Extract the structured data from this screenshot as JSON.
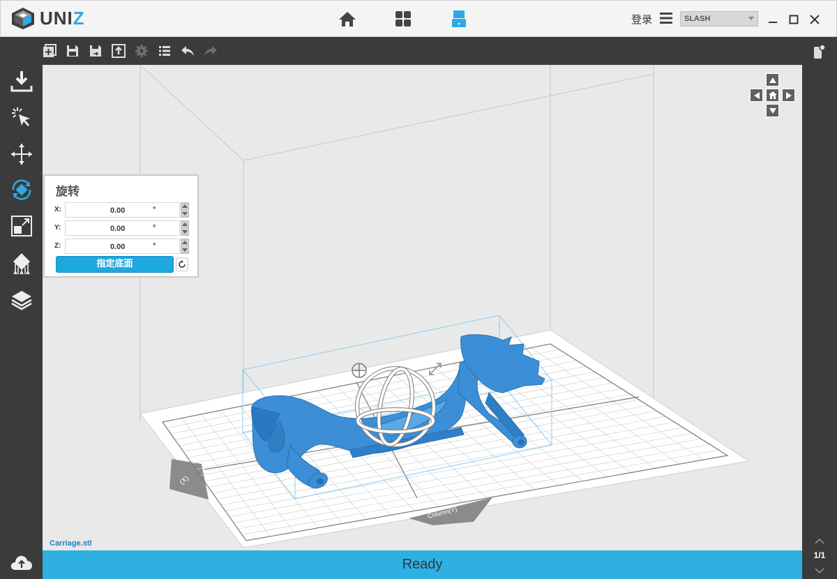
{
  "app": {
    "logo_text": "UNI",
    "logo_accent": "Z",
    "accent_color": "#2fa9e3"
  },
  "titlebar": {
    "nav": [
      {
        "name": "home-icon"
      },
      {
        "name": "grid-icon"
      },
      {
        "name": "printer-icon",
        "active": true
      }
    ],
    "login_label": "登录",
    "printer_model": "SLASH"
  },
  "toolbar": {
    "icons": [
      "add-model-icon",
      "save-icon",
      "save-as-icon",
      "export-icon",
      "settings-icon",
      "list-icon",
      "undo-icon",
      "redo-icon"
    ]
  },
  "sidebar": {
    "tools": [
      "import-icon",
      "select-icon",
      "move-icon",
      "rotate-icon",
      "scale-icon",
      "support-icon",
      "layers-icon"
    ],
    "active_tool": "rotate-icon"
  },
  "rotate_panel": {
    "title": "旋转",
    "rows": [
      {
        "label": "X:",
        "value": "0.00",
        "unit": "°"
      },
      {
        "label": "Y:",
        "value": "0.00",
        "unit": "°"
      },
      {
        "label": "Z:",
        "value": "0.00",
        "unit": "°"
      }
    ],
    "button_label": "指定底面"
  },
  "viewport": {
    "filename": "Carriage.stl",
    "axis_labels": {
      "x": "(X)",
      "y": "Column(Y)"
    }
  },
  "pager": {
    "label": "1/1"
  },
  "status": {
    "text": "Ready"
  }
}
